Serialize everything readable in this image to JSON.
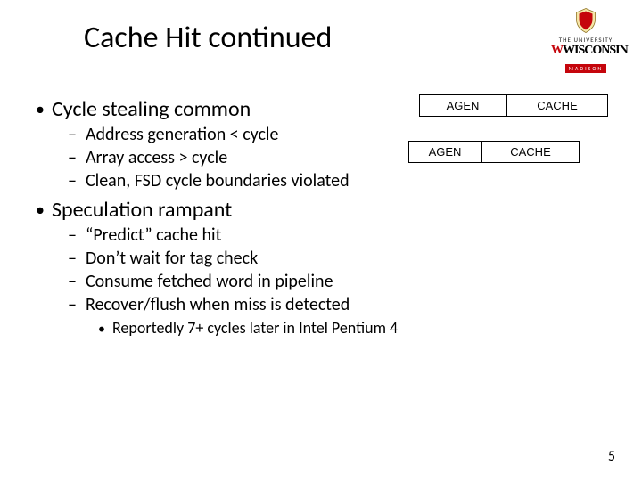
{
  "title": "Cache Hit continued",
  "logo": {
    "university": "THE UNIVERSITY",
    "name_html": "WISCONSIN",
    "city": "MADISON"
  },
  "boxes": {
    "agen": "AGEN",
    "cache": "CACHE"
  },
  "bullets": {
    "b1": "Cycle stealing common",
    "b1_subs": [
      "Address generation < cycle",
      "Array access > cycle",
      "Clean, FSD cycle boundaries violated"
    ],
    "b2": "Speculation rampant",
    "b2_subs": [
      "“Predict” cache hit",
      "Don’t wait for tag check",
      "Consume fetched word in pipeline",
      "Recover/flush when miss is detected"
    ],
    "b2_note": "Reportedly 7+ cycles later in Intel Pentium 4"
  },
  "page_number": "5"
}
